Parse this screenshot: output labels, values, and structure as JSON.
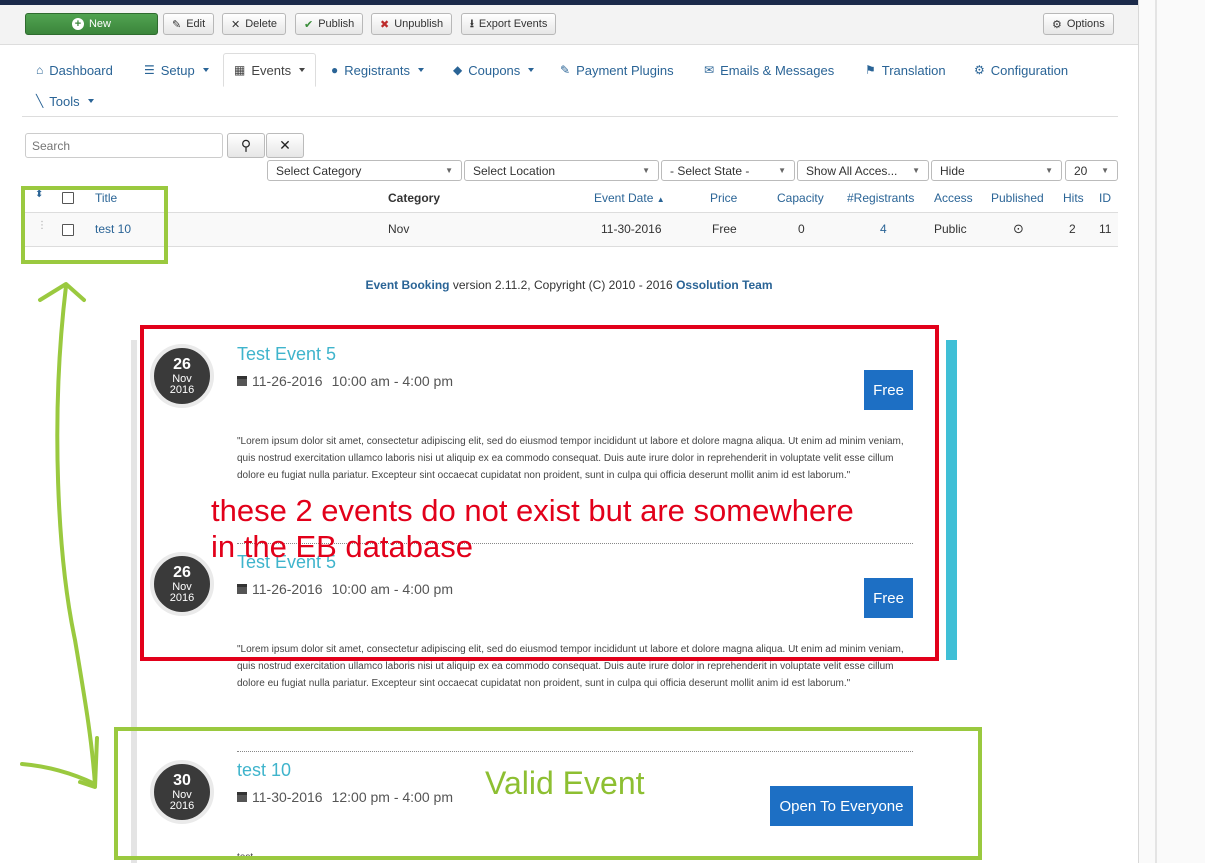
{
  "toolbar": {
    "new_label": "New",
    "edit_label": "Edit",
    "delete_label": "Delete",
    "publish_label": "Publish",
    "unpublish_label": "Unpublish",
    "export_label": "Export Events",
    "options_label": "Options"
  },
  "nav": {
    "dashboard": "Dashboard",
    "setup": "Setup",
    "events": "Events",
    "registrants": "Registrants",
    "coupons": "Coupons",
    "payment_plugins": "Payment Plugins",
    "emails_messages": "Emails & Messages",
    "translation": "Translation",
    "configuration": "Configuration",
    "tools": "Tools"
  },
  "filters": {
    "search_placeholder": "Search",
    "category": "Select Category",
    "location": "Select Location",
    "state": "- Select State -",
    "access": "Show All Acces...",
    "hide": "Hide",
    "limit": "20"
  },
  "table": {
    "headers": {
      "title": "Title",
      "category": "Category",
      "event_date": "Event Date",
      "price": "Price",
      "capacity": "Capacity",
      "registrants": "#Registrants",
      "access": "Access",
      "published": "Published",
      "hits": "Hits",
      "id": "ID"
    },
    "rows": [
      {
        "title": "test 10",
        "category": "Nov",
        "event_date": "11-30-2016",
        "price": "Free",
        "capacity": "0",
        "registrants": "4",
        "access": "Public",
        "hits": "2",
        "id": "11"
      }
    ]
  },
  "footer": {
    "product": "Event Booking",
    "version_text": " version 2.11.2, Copyright (C) 2010 - 2016 ",
    "company": "Ossolution Team"
  },
  "events": [
    {
      "day": "26",
      "month": "Nov",
      "year": "2016",
      "title": "Test Event 5",
      "date": "11-26-2016",
      "time": "10:00 am - 4:00 pm",
      "price": "Free",
      "description": "\"Lorem ipsum dolor sit amet, consectetur adipiscing elit, sed do eiusmod tempor incididunt ut labore et dolore magna aliqua. Ut enim ad minim veniam, quis nostrud exercitation ullamco laboris nisi ut aliquip ex ea commodo consequat. Duis aute irure dolor in reprehenderit in voluptate velit esse cillum dolore eu fugiat nulla pariatur. Excepteur sint occaecat cupidatat non proident, sunt in culpa qui officia deserunt mollit anim id est laborum.\""
    },
    {
      "day": "26",
      "month": "Nov",
      "year": "2016",
      "title": "Test Event 5",
      "date": "11-26-2016",
      "time": "10:00 am - 4:00 pm",
      "price": "Free",
      "description": "\"Lorem ipsum dolor sit amet, consectetur adipiscing elit, sed do eiusmod tempor incididunt ut labore et dolore magna aliqua. Ut enim ad minim veniam, quis nostrud exercitation ullamco laboris nisi ut aliquip ex ea commodo consequat. Duis aute irure dolor in reprehenderit in voluptate velit esse cillum dolore eu fugiat nulla pariatur. Excepteur sint occaecat cupidatat non proident, sunt in culpa qui officia deserunt mollit anim id est laborum.\""
    },
    {
      "day": "30",
      "month": "Nov",
      "year": "2016",
      "title": "test 10",
      "date": "11-30-2016",
      "time": "12:00 pm - 4:00 pm",
      "price": "Open To Everyone",
      "description": "test"
    }
  ],
  "annotations": {
    "red_note_line1": "these 2 events do not exist but are somewhere",
    "red_note_line2": "in the EB database",
    "green_note": "Valid Event"
  },
  "colors": {
    "accent_green": "#9ac93f",
    "accent_red": "#e2001a",
    "link_blue": "#2a6496",
    "teal": "#3fbfd6",
    "price_blue": "#1d6fc4"
  }
}
